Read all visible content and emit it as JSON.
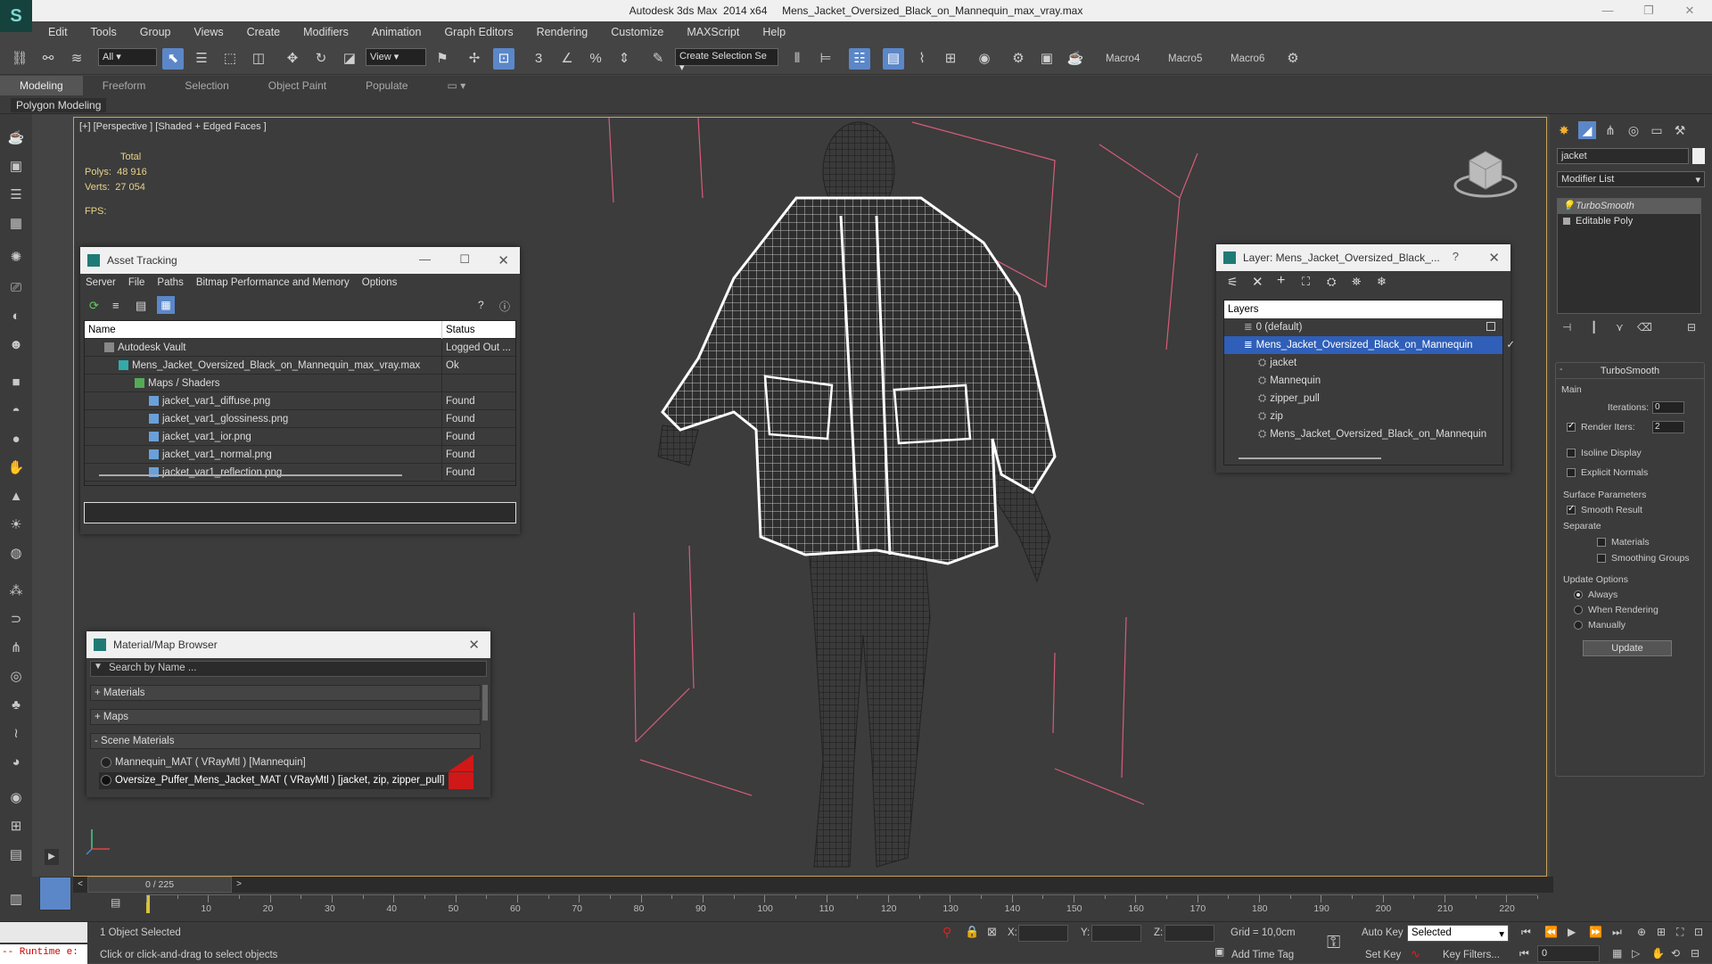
{
  "window": {
    "title": "Autodesk 3ds Max  2014 x64     Mens_Jacket_Oversized_Black_on_Mannequin_max_vray.max"
  },
  "menu": [
    "Edit",
    "Tools",
    "Group",
    "Views",
    "Create",
    "Modifiers",
    "Animation",
    "Graph Editors",
    "Rendering",
    "Customize",
    "MAXScript",
    "Help"
  ],
  "toolbar": {
    "filter": "All",
    "refcoord": "View",
    "selset": "Create Selection Se",
    "macros": [
      "Macro4",
      "Macro5",
      "Macro6"
    ]
  },
  "ribbon": {
    "tabs": [
      "Modeling",
      "Freeform",
      "Selection",
      "Object Paint",
      "Populate"
    ],
    "active": "Modeling",
    "sub": "Polygon Modeling"
  },
  "viewport": {
    "label": "[+] [Perspective ] [Shaded + Edged Faces ]",
    "total": "Total",
    "polys_label": "Polys:",
    "polys": "48 916",
    "verts_label": "Verts:",
    "verts": "27 054",
    "fps_label": "FPS:"
  },
  "asset_tracking": {
    "title": "Asset Tracking",
    "menu": [
      "Server",
      "File",
      "Paths",
      "Bitmap Performance and Memory",
      "Options"
    ],
    "columns": [
      "Name",
      "Status"
    ],
    "rows": [
      {
        "name": "Autodesk Vault",
        "status": "Logged Out ..."
      },
      {
        "name": "Mens_Jacket_Oversized_Black_on_Mannequin_max_vray.max",
        "status": "Ok"
      },
      {
        "name": "Maps / Shaders",
        "status": ""
      },
      {
        "name": "jacket_var1_diffuse.png",
        "status": "Found"
      },
      {
        "name": "jacket_var1_glossiness.png",
        "status": "Found"
      },
      {
        "name": "jacket_var1_ior.png",
        "status": "Found"
      },
      {
        "name": "jacket_var1_normal.png",
        "status": "Found"
      },
      {
        "name": "jacket_var1_reflection.png",
        "status": "Found"
      }
    ]
  },
  "material_browser": {
    "title": "Material/Map Browser",
    "search_placeholder": "Search by Name ...",
    "groups": [
      "+ Materials",
      "+ Maps",
      "- Scene Materials"
    ],
    "items": [
      "Mannequin_MAT  ( VRayMtl )  [Mannequin]",
      "Oversize_Puffer_Mens_Jacket_MAT  ( VRayMtl )  [jacket, zip, zipper_pull]"
    ]
  },
  "layer_dialog": {
    "title": "Layer: Mens_Jacket_Oversized_Black_...",
    "header": "Layers",
    "items": [
      "0 (default)",
      "Mens_Jacket_Oversized_Black_on_Mannequin",
      "jacket",
      "Mannequin",
      "zipper_pull",
      "zip",
      "Mens_Jacket_Oversized_Black_on_Mannequin"
    ]
  },
  "command_panel": {
    "name": "jacket",
    "modlist": "Modifier List",
    "stack": [
      "TurboSmooth",
      "Editable Poly"
    ],
    "rollout": "TurboSmooth",
    "main": "Main",
    "iterations_label": "Iterations:",
    "iterations": "0",
    "render_iters_label": "Render Iters:",
    "render_iters": "2",
    "isoline": "Isoline Display",
    "explicit": "Explicit Normals",
    "surface": "Surface Parameters",
    "smooth": "Smooth Result",
    "separate": "Separate",
    "materials": "Materials",
    "smoothing": "Smoothing Groups",
    "update_opts": "Update Options",
    "always": "Always",
    "when_rendering": "When Rendering",
    "manually": "Manually",
    "update_btn": "Update"
  },
  "timeline": {
    "frame": "0 / 225",
    "ticks": [
      "10",
      "20",
      "30",
      "40",
      "50",
      "60",
      "70",
      "80",
      "90",
      "100",
      "110",
      "120",
      "130",
      "140",
      "150",
      "160",
      "170",
      "180",
      "190",
      "200",
      "210",
      "220"
    ]
  },
  "status": {
    "runtime": "-- Runtime e:",
    "selected": "1 Object Selected",
    "prompt": "Click or click-and-drag to select objects",
    "x": "X:",
    "y": "Y:",
    "z": "Z:",
    "grid": "Grid = 10,0cm",
    "autokey": "Auto Key",
    "setkey": "Set Key",
    "selmode": "Selected",
    "keyfilters": "Key Filters...",
    "addtimetag": "Add Time Tag",
    "frameval": "0"
  }
}
